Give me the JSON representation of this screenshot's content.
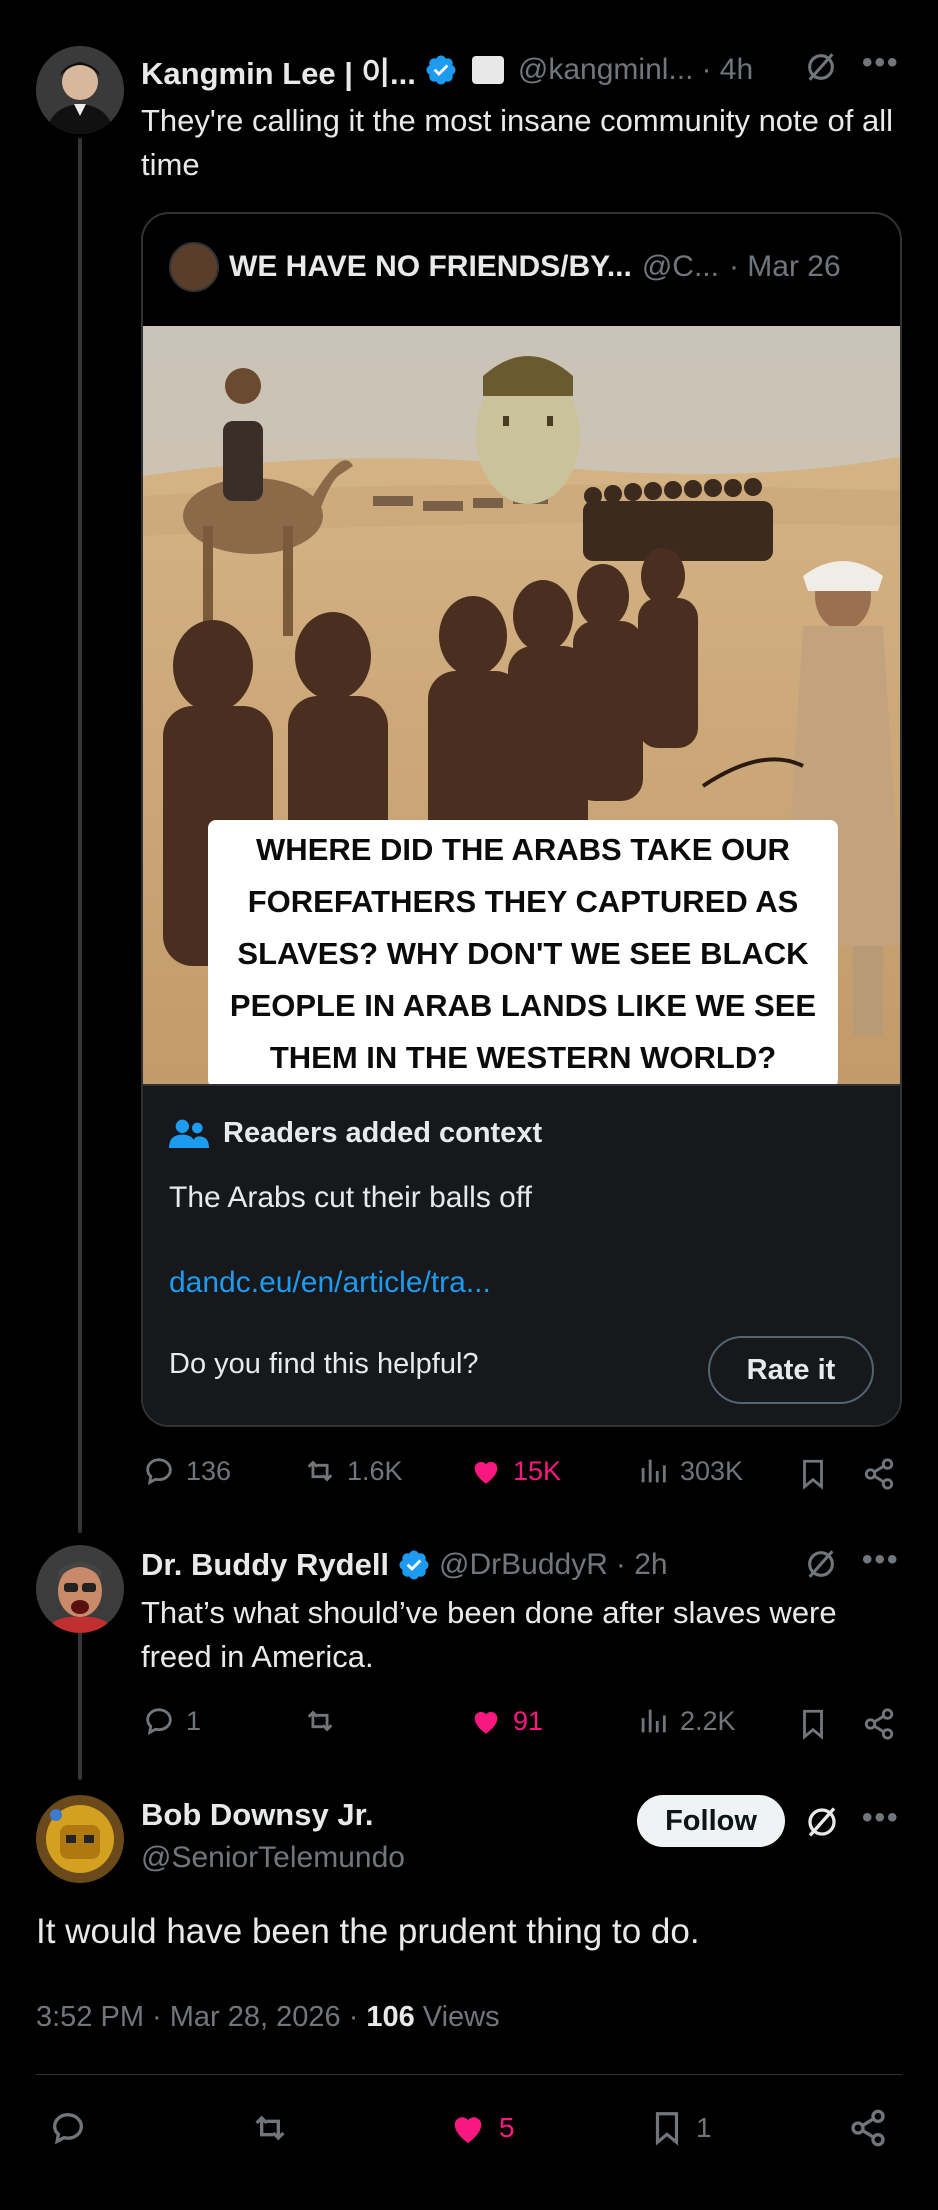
{
  "colors": {
    "background": "#000000",
    "text": "#e7e9ea",
    "muted": "#71767b",
    "accent": "#1d9bf0",
    "like": "#f91880",
    "context_bg": "#16181c"
  },
  "tweet1": {
    "name": "Kangmin Lee | 이...",
    "handle": "@kangminl...",
    "time": "· 4h",
    "text": "They're calling it the most insane community note of all time",
    "quote": {
      "name": "WE HAVE NO FRIENDS/BY...",
      "handle": "@C...",
      "time": "· Mar 26",
      "image_caption": "WHERE DID THE ARABS TAKE OUR FOREFATHERS THEY CAPTURED AS SLAVES? WHY DON'T WE SEE BLACK PEOPLE IN ARAB LANDS LIKE WE SEE THEM IN THE WESTERN WORLD?",
      "context_title": "Readers added context",
      "context_text": "The Arabs cut their balls off",
      "context_link": "dandc.eu/en/article/tra...",
      "helpful_prompt": "Do you find this helpful?",
      "rate_label": "Rate it"
    },
    "stats": {
      "replies": "136",
      "reposts": "1.6K",
      "likes": "15K",
      "views": "303K"
    }
  },
  "tweet2": {
    "name": "Dr. Buddy Rydell",
    "handle": "@DrBuddyR",
    "time": "· 2h",
    "text": "That’s what should’ve been done after slaves were freed in America.",
    "stats": {
      "replies": "1",
      "reposts": "",
      "likes": "91",
      "views": "2.2K"
    }
  },
  "tweet3": {
    "name": "Bob Downsy Jr.",
    "handle": "@SeniorTelemundo",
    "follow_label": "Follow",
    "text": "It would have been the prudent thing to do.",
    "timestamp": "3:52 PM · Mar 28, 2026 ·",
    "views_count": "106",
    "views_label": "Views",
    "stats": {
      "likes": "5",
      "bookmarks": "1"
    }
  }
}
